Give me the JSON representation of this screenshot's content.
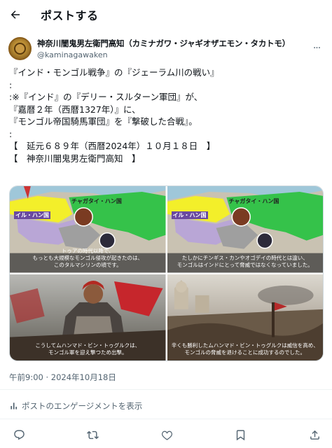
{
  "header": {
    "title": "ポストする"
  },
  "author": {
    "display_name": "神奈川闇鬼男左衛門高知（カミナガワ・ジャギオザエモン・タカトモ）",
    "handle": "@kaminagawaken"
  },
  "tweet": {
    "lines": [
      "『インド・モンゴル戦争』の『ジェーラム川の戦い』",
      ":",
      ":※『インド』の『デリー・スルターン軍団』が、",
      "『嘉暦２年（西暦1327年）』に、",
      "『モンゴル帝国騎馬軍団』を『撃破した合戦』。",
      ":",
      "【　延元６８９年（西暦2024年）１０月１８日　】",
      "【　神奈川闇鬼男左衛門高知　】"
    ]
  },
  "media": {
    "map_label_chagatai": "チャガタイ・ハン国",
    "map_label_ilkhan": "イル・ハン国",
    "captions": [
      "トゥアの時代以降で、\nもっとも大規模なモンゴル侵攻が起きたのは、\nこのタルマシリンの頃です。",
      "たしかにチンギス・カンやオゴデイの時代とは違い、\nモンゴルはインドにとって脅威ではなくなっていました。",
      "こうしてムハンマド・ビン・トゥグルクは、\nモンゴル軍を迎え撃つため出撃。",
      "辛くも勝利したムハンマド・ビン・トゥグルクは威信を高め、\nモンゴルの脅威を退けることに成功するのでした。"
    ]
  },
  "timestamp": "午前9:00 · 2024年10月18日",
  "engagement_label": "ポストのエンゲージメントを表示",
  "icons": [
    "back-arrow-icon",
    "more-icon",
    "reply-icon",
    "repost-icon",
    "like-icon",
    "bookmark-icon",
    "share-icon",
    "analytics-icon"
  ]
}
